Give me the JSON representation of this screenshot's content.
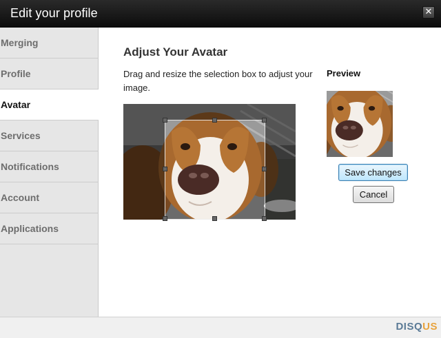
{
  "window": {
    "title": "Edit your profile",
    "close_icon": "close-icon"
  },
  "sidebar": {
    "items": [
      {
        "label": "Merging",
        "active": false
      },
      {
        "label": "Profile",
        "active": false
      },
      {
        "label": "Avatar",
        "active": true
      },
      {
        "label": "Services",
        "active": false
      },
      {
        "label": "Notifications",
        "active": false
      },
      {
        "label": "Account",
        "active": false
      },
      {
        "label": "Applications",
        "active": false
      }
    ]
  },
  "main": {
    "heading": "Adjust Your Avatar",
    "instructions": "Drag and resize the selection box to adjust your image.",
    "preview_label": "Preview",
    "save_label": "Save changes",
    "cancel_label": "Cancel"
  },
  "footer": {
    "brand_part1": "DISQ",
    "brand_part2": "US"
  },
  "colors": {
    "titlebar": "#1b1b1b",
    "sidebar_bg": "#e6e6e6",
    "save_button_border": "#3c7fb1",
    "brand_blue": "#5a7a96",
    "brand_orange": "#e8a33d"
  }
}
